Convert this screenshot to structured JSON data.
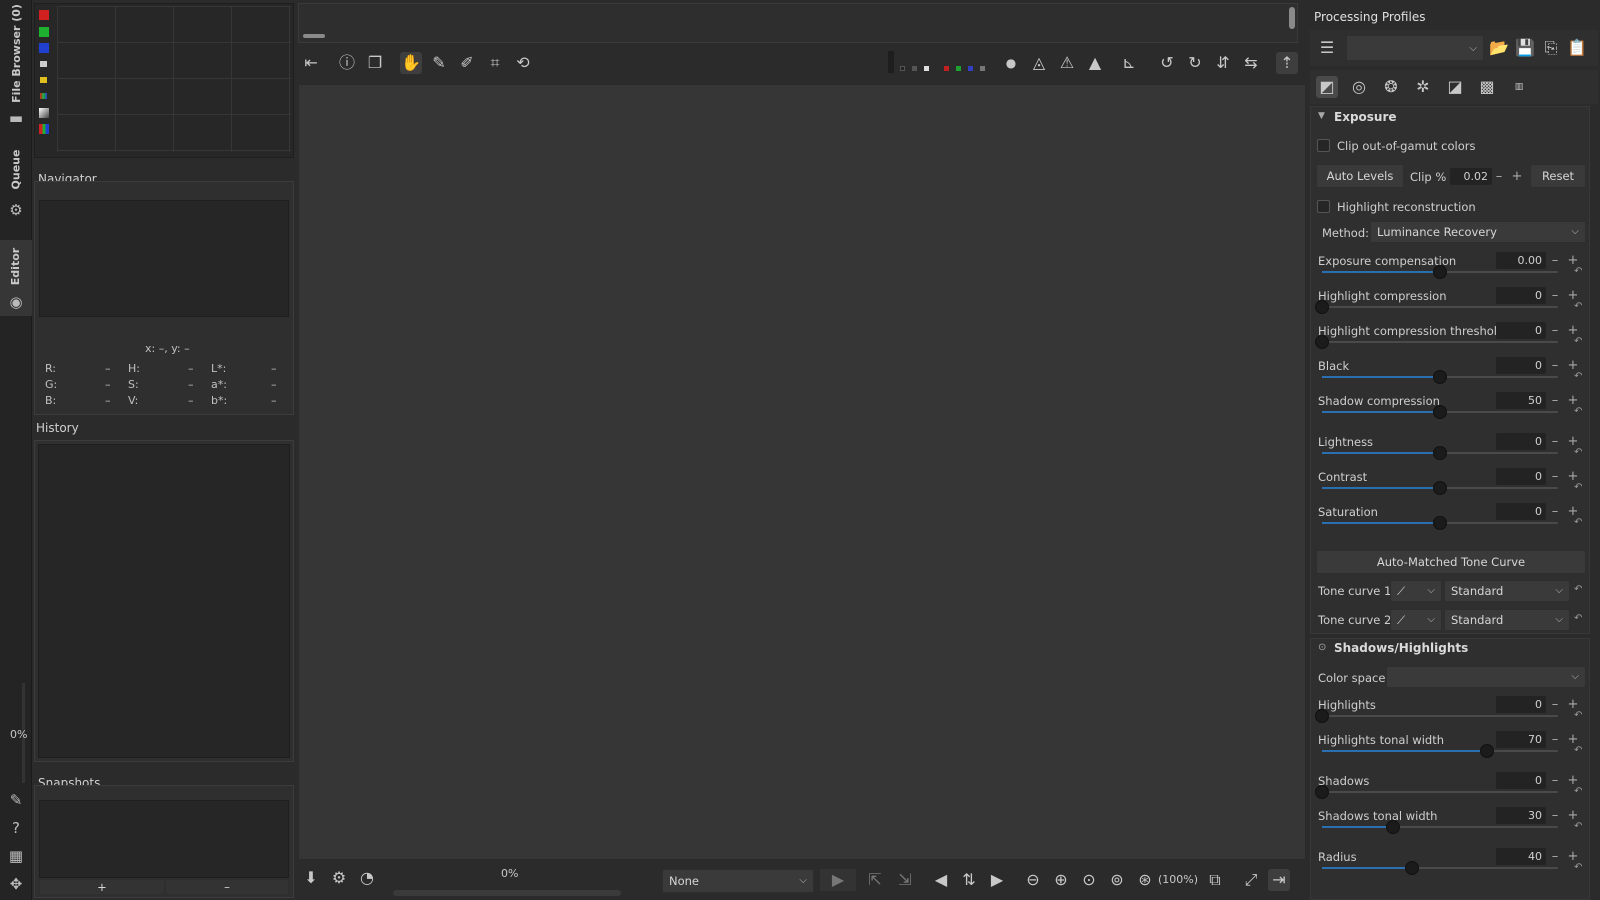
{
  "sidebar": {
    "file_browser": "File Browser (0)",
    "queue": "Queue",
    "editor": "Editor",
    "progress": "0%"
  },
  "navigator": {
    "title": "Navigator",
    "coords": "x: –, y: –",
    "r": "R:",
    "g": "G:",
    "b": "B:",
    "h": "H:",
    "s": "S:",
    "v": "V:",
    "l": "L*:",
    "a": "a*:",
    "bb": "b*:",
    "dash": "–"
  },
  "history": {
    "title": "History"
  },
  "snapshots": {
    "title": "Snapshots",
    "add": "+",
    "remove": "–"
  },
  "bottombar": {
    "progress": "0%",
    "profile_select": "None",
    "zoom": "(100%)"
  },
  "profiles": {
    "title": "Processing Profiles",
    "selected": ""
  },
  "exposure": {
    "section_title": "Exposure",
    "clip_gamut": "Clip out-of-gamut colors",
    "auto_levels": "Auto Levels",
    "clip_label": "Clip %",
    "clip_value": "0.02",
    "reset": "Reset",
    "highlight_recon": "Highlight reconstruction",
    "method_label": "Method:",
    "method_value": "Luminance Recovery",
    "sliders": [
      {
        "label": "Exposure compensation",
        "value": "0.00",
        "fraction": 0.5
      },
      {
        "label": "Highlight compression",
        "value": "0",
        "fraction": 0.0
      },
      {
        "label": "Highlight compression threshold",
        "value": "0",
        "fraction": 0.0
      },
      {
        "label": "Black",
        "value": "0",
        "fraction": 0.5
      },
      {
        "label": "Shadow compression",
        "value": "50",
        "fraction": 0.5
      },
      {
        "label": "Lightness",
        "value": "0",
        "fraction": 0.5
      },
      {
        "label": "Contrast",
        "value": "0",
        "fraction": 0.5
      },
      {
        "label": "Saturation",
        "value": "0",
        "fraction": 0.5
      }
    ],
    "auto_matched": "Auto-Matched Tone Curve",
    "tone_curve_1_label": "Tone curve 1:",
    "tone_curve_1_value": "Standard",
    "tone_curve_2_label": "Tone curve 2:",
    "tone_curve_2_value": "Standard"
  },
  "shadows_highlights": {
    "section_title": "Shadows/Highlights",
    "color_space_label": "Color space:",
    "color_space_value": "",
    "sliders": [
      {
        "label": "Highlights",
        "value": "0",
        "fraction": 0.0
      },
      {
        "label": "Highlights tonal width",
        "value": "70",
        "fraction": 0.7
      },
      {
        "label": "Shadows",
        "value": "0",
        "fraction": 0.0
      },
      {
        "label": "Shadows tonal width",
        "value": "30",
        "fraction": 0.3
      },
      {
        "label": "Radius",
        "value": "40",
        "fraction": 0.38
      }
    ]
  },
  "colors": {
    "accent": "#2a6fb0",
    "bg": "#2b2b2b"
  }
}
